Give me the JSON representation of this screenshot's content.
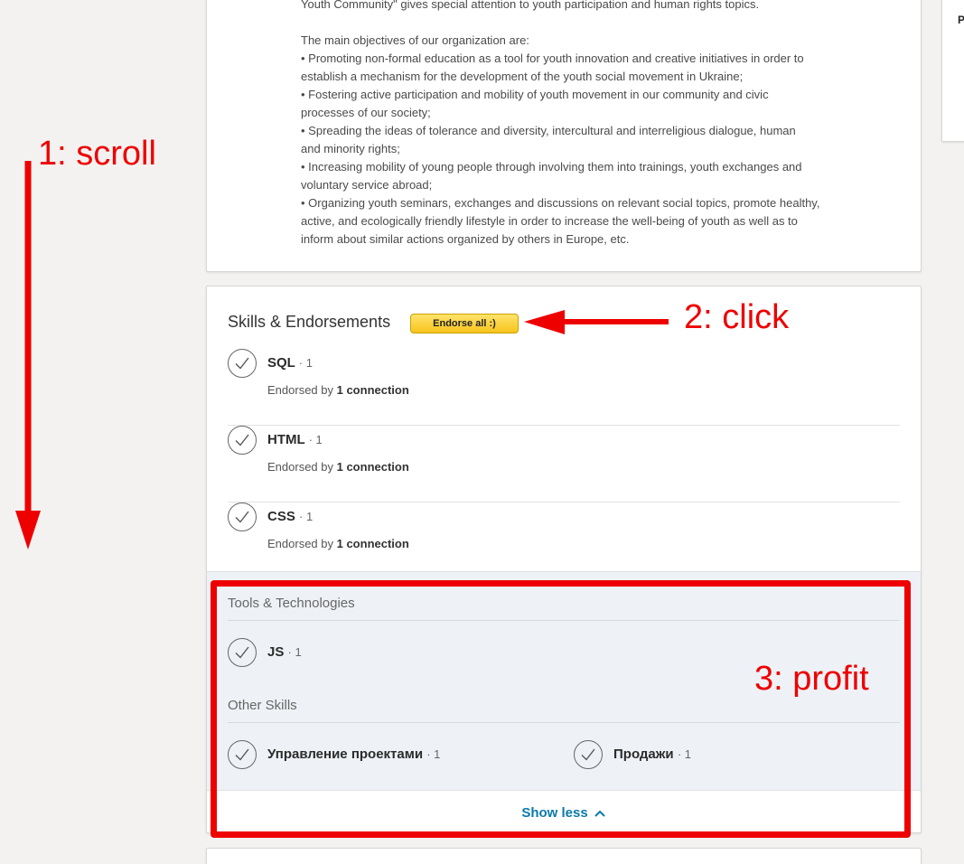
{
  "about": {
    "lines": [
      "Youth Community\" gives special attention to youth participation and human rights topics.",
      "",
      "The main objectives of our organization are:",
      "• Promoting non-formal education as a tool for youth innovation and creative initiatives in order to",
      "establish a mechanism for the development of the youth social movement in Ukraine;",
      "• Fostering active participation and mobility of youth movement in our community and civic",
      "processes of our society;",
      "• Spreading the ideas of tolerance and diversity, intercultural and interreligious dialogue, human",
      "and minority rights;",
      "• Increasing mobility of young people through involving them into trainings, youth exchanges and",
      "voluntary service abroad;",
      "• Organizing youth seminars, exchanges and discussions on relevant social topics, promote healthy,",
      "active, and ecologically friendly lifestyle in order to increase the well-being of youth as well as to",
      "inform about similar actions organized by others in Europe, etc."
    ]
  },
  "right_panel": {
    "letter": "P"
  },
  "skills": {
    "title": "Skills & Endorsements",
    "endorse_all_label": "Endorse all :)",
    "top": [
      {
        "name": "SQL",
        "count": "· 1",
        "endorsed_prefix": "Endorsed by ",
        "endorsed_bold": "1 connection"
      },
      {
        "name": "HTML",
        "count": "· 1",
        "endorsed_prefix": "Endorsed by ",
        "endorsed_bold": "1 connection"
      },
      {
        "name": "CSS",
        "count": "· 1",
        "endorsed_prefix": "Endorsed by ",
        "endorsed_bold": "1 connection"
      }
    ],
    "tools_label": "Tools & Technologies",
    "tools": [
      {
        "name": "JS",
        "count": "· 1"
      }
    ],
    "other_label": "Other Skills",
    "other": [
      {
        "name": "Управление проектами",
        "count": "· 1"
      },
      {
        "name": "Продажи",
        "count": "· 1"
      }
    ],
    "show_less_label": "Show less"
  },
  "annotations": {
    "step1": "1: scroll",
    "step2": "2: click",
    "step3": "3: profit",
    "color": "#ee0000"
  },
  "colors": {
    "accent_link": "#0a7aa8",
    "endorse_button": "#f7c41c",
    "expanded_bg": "#eef2f6"
  }
}
